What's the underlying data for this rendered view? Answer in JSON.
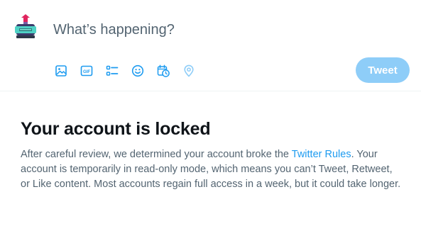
{
  "composer": {
    "placeholder": "What’s happening?",
    "avatar_icon": "robot-avatar-icon",
    "toolbar": [
      {
        "name": "media",
        "icon": "image-icon"
      },
      {
        "name": "gif",
        "icon": "gif-icon",
        "label": "GIF"
      },
      {
        "name": "poll",
        "icon": "poll-icon"
      },
      {
        "name": "emoji",
        "icon": "emoji-icon"
      },
      {
        "name": "schedule",
        "icon": "schedule-icon"
      },
      {
        "name": "location",
        "icon": "location-pin-icon"
      }
    ],
    "tweet_label": "Tweet",
    "tweet_button_disabled": true
  },
  "notice": {
    "title": "Your account is locked",
    "body_before": "After careful review, we determined your account broke the ",
    "link_text": "Twitter Rules",
    "body_after": ". Your account is temporarily in read-only mode, which means you can’t Tweet, Retweet, or Like content. Most accounts regain full access in a week, but it could take longer."
  },
  "colors": {
    "accent": "#1d9bf0",
    "tweet_button_disabled_bg": "#8ecdf8",
    "location_icon_disabled": "#8ecdf8",
    "text_primary": "#0f1419",
    "text_secondary": "#536471",
    "divider": "#eff3f4"
  }
}
